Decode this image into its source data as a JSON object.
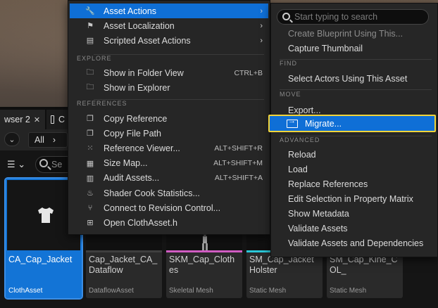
{
  "content_browser": {
    "tab1_label": "wser 2",
    "tab1_close": "✕",
    "tab2_label": "C",
    "path_all": "All",
    "path_chevron": "›",
    "search_placeholder": "Se",
    "filter_glyph": "☰",
    "filter_caret": "⌄"
  },
  "tiles": [
    {
      "name": "CA_Cap_Jacket",
      "type": "ClothAsset",
      "selected": true,
      "bar_color": "#1374d6"
    },
    {
      "name": "Cap_Jacket_CA_Dataflow",
      "type": "DataflowAsset",
      "selected": false,
      "bar_color": "#3f3f3f"
    },
    {
      "name": "SKM_Cap_Clothes",
      "type": "Skeletal Mesh",
      "selected": false,
      "bar_color": "#d05cc2"
    },
    {
      "name": "SM_Cap_Jacket Holster",
      "type": "Static Mesh",
      "selected": false,
      "bar_color": "#2ac7d8"
    },
    {
      "name": "SM_Cap_Kine_COL_",
      "type": "Static Mesh",
      "selected": false,
      "bar_color": "#2ac7d8"
    }
  ],
  "left_menu": {
    "items_top": [
      {
        "label": "Asset Actions",
        "icon": "wrench-icon",
        "glyph": "🔧",
        "arrow": "›",
        "highlighted": true
      },
      {
        "label": "Asset Localization",
        "icon": "flag-icon",
        "glyph": "⚑",
        "arrow": "›"
      },
      {
        "label": "Scripted Asset Actions",
        "icon": "script-icon",
        "glyph": "▤",
        "arrow": "›"
      }
    ],
    "section_explore": "EXPLORE",
    "explore": [
      {
        "label": "Show in Folder View",
        "icon": "folder-search-icon",
        "glyph": "🗀",
        "shortcut": "CTRL+B"
      },
      {
        "label": "Show in Explorer",
        "icon": "folder-search-icon",
        "glyph": "🗀"
      }
    ],
    "section_references": "REFERENCES",
    "references": [
      {
        "label": "Copy Reference",
        "icon": "copy-icon",
        "glyph": "❐"
      },
      {
        "label": "Copy File Path",
        "icon": "copy-icon",
        "glyph": "❐"
      },
      {
        "label": "Reference Viewer...",
        "icon": "reference-viewer-icon",
        "glyph": "⁙",
        "shortcut": "ALT+SHIFT+R"
      },
      {
        "label": "Size Map...",
        "icon": "size-map-icon",
        "glyph": "▦",
        "shortcut": "ALT+SHIFT+M"
      },
      {
        "label": "Audit Assets...",
        "icon": "audit-icon",
        "glyph": "▥",
        "shortcut": "ALT+SHIFT+A"
      },
      {
        "label": "Shader Cook Statistics...",
        "icon": "shader-icon",
        "glyph": "♨"
      },
      {
        "label": "Connect to Revision Control...",
        "icon": "revision-control-icon",
        "glyph": "⑂"
      },
      {
        "label": "Open ClothAsset.h",
        "icon": "cpp-file-icon",
        "glyph": "⊞"
      }
    ]
  },
  "right_menu": {
    "search_placeholder": "Start typing to search",
    "item_create_blueprint": "Create Blueprint Using This...",
    "item_capture_thumbnail": "Capture Thumbnail",
    "section_find": "FIND",
    "item_select_actors": "Select Actors Using This Asset",
    "section_move": "MOVE",
    "item_export": "Export...",
    "item_migrate": "Migrate...",
    "section_advanced": "ADVANCED",
    "advanced": [
      "Reload",
      "Load",
      "Replace References",
      "Edit Selection in Property Matrix",
      "Show Metadata",
      "Validate Assets",
      "Validate Assets and Dependencies"
    ]
  }
}
